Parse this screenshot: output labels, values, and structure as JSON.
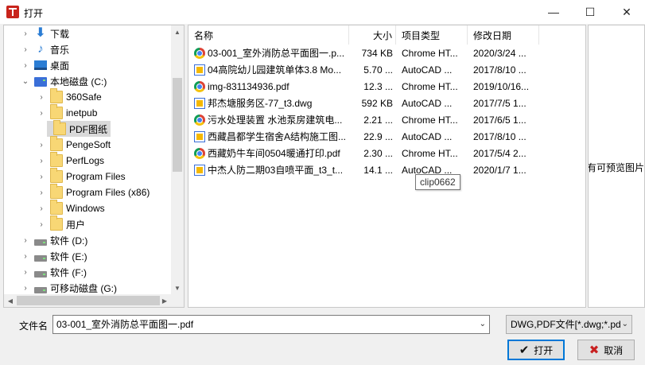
{
  "window": {
    "title": "打开",
    "minimize": "—",
    "maximize": "☐",
    "close": "✕"
  },
  "tree": [
    {
      "label": "下载",
      "icon": "download-icon",
      "chevron": "›"
    },
    {
      "label": "音乐",
      "icon": "music-icon",
      "chevron": "›"
    },
    {
      "label": "桌面",
      "icon": "desktop-icon",
      "chevron": "›"
    },
    {
      "label": "本地磁盘 (C:)",
      "icon": "drive-c-icon",
      "chevron": "⌄"
    },
    {
      "label": "360Safe",
      "icon": "folder-icon",
      "chevron": "›"
    },
    {
      "label": "inetpub",
      "icon": "folder-icon",
      "chevron": "›"
    },
    {
      "label": "PDF图纸",
      "icon": "folder-icon",
      "chevron": "",
      "selected": true
    },
    {
      "label": "PengeSoft",
      "icon": "folder-icon",
      "chevron": "›"
    },
    {
      "label": "PerfLogs",
      "icon": "folder-icon",
      "chevron": "›"
    },
    {
      "label": "Program Files",
      "icon": "folder-icon",
      "chevron": "›"
    },
    {
      "label": "Program Files (x86)",
      "icon": "folder-icon",
      "chevron": "›"
    },
    {
      "label": "Windows",
      "icon": "folder-icon",
      "chevron": "›"
    },
    {
      "label": "用户",
      "icon": "folder-icon",
      "chevron": "›"
    },
    {
      "label": "软件 (D:)",
      "icon": "drive-icon",
      "chevron": "›"
    },
    {
      "label": "软件 (E:)",
      "icon": "drive-icon",
      "chevron": "›"
    },
    {
      "label": "软件 (F:)",
      "icon": "drive-icon",
      "chevron": "›"
    },
    {
      "label": "可移动磁盘 (G:)",
      "icon": "drive-icon",
      "chevron": "›"
    }
  ],
  "columns": {
    "name": "名称",
    "size": "大小",
    "type": "项目类型",
    "date": "修改日期"
  },
  "files": [
    {
      "name": "03-001_室外消防总平面图一.p...",
      "size": "734 KB",
      "type": "Chrome HT...",
      "date": "2020/3/24 ...",
      "icon": "chrome-icon"
    },
    {
      "name": "04高院幼儿园建筑单体3.8 Mo...",
      "size": "5.70 ...",
      "type": "AutoCAD ...",
      "date": "2017/8/10 ...",
      "icon": "dwg-icon"
    },
    {
      "name": "img-831134936.pdf",
      "size": "12.3 ...",
      "type": "Chrome HT...",
      "date": "2019/10/16...",
      "icon": "chrome-icon"
    },
    {
      "name": "邦杰塘服务区-77_t3.dwg",
      "size": "592 KB",
      "type": "AutoCAD ...",
      "date": "2017/7/5 1...",
      "icon": "dwg-icon"
    },
    {
      "name": "污水处理装置 水池泵房建筑电...",
      "size": "2.21 ...",
      "type": "Chrome HT...",
      "date": "2017/6/5 1...",
      "icon": "chrome-icon"
    },
    {
      "name": "西藏昌都学生宿舍A结构施工图...",
      "size": "22.9 ...",
      "type": "AutoCAD ...",
      "date": "2017/8/10 ...",
      "icon": "dwg-icon"
    },
    {
      "name": "西藏奶牛车间0504暖通打印.pdf",
      "size": "2.30 ...",
      "type": "Chrome HT...",
      "date": "2017/5/4 2...",
      "icon": "chrome-icon"
    },
    {
      "name": "中杰人防二期03自喷平面_t3_t...",
      "size": "14.1 ...",
      "type": "AutoCAD ...",
      "date": "2020/1/7 1...",
      "icon": "dwg-icon"
    }
  ],
  "tooltip": "clip0662",
  "preview": {
    "text": "没有可预览图片"
  },
  "footer": {
    "filename_label": "文件名",
    "filename_value": "03-001_室外消防总平面图一.pdf",
    "filetype_value": "DWG,PDF文件[*.dwg;*.pdf]",
    "dropdown_glyph": "⌄",
    "open_label": "打开",
    "cancel_label": "取消",
    "open_icon": "✔",
    "cancel_icon": "✖"
  }
}
